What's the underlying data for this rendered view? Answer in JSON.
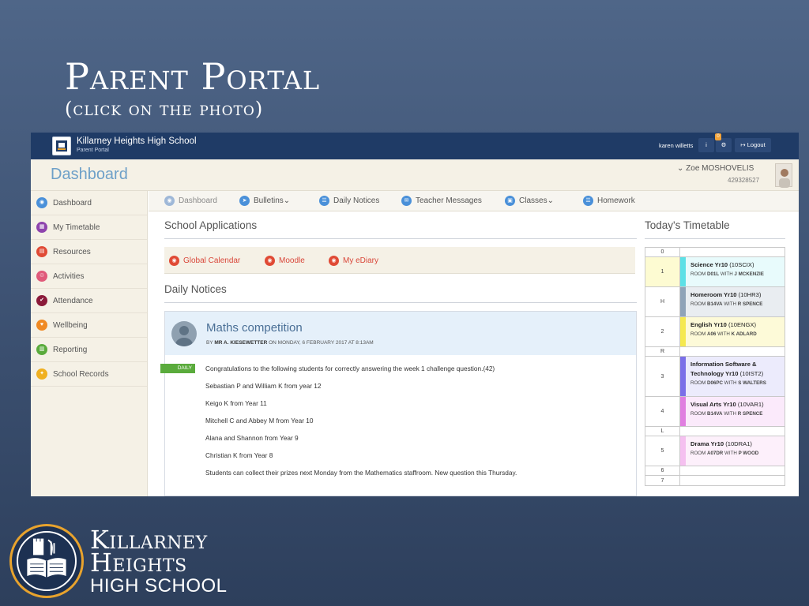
{
  "slide": {
    "title": "Parent Portal",
    "subtitle": "(click on the photo)"
  },
  "topbar": {
    "school_name": "Killarney Heights High School",
    "portal_name": "Parent Portal",
    "user": "karen willetts",
    "info_icon": "i",
    "settings_badge": "0",
    "logout_label": "↦ Logout"
  },
  "dashbar": {
    "title": "Dashboard",
    "student_name": "⌄  Zoe MOSHOVELIS",
    "student_id": "429328527"
  },
  "sidebar": {
    "items": [
      {
        "label": "Dashboard",
        "icon": "dashboard-icon",
        "color": "#4a90d9"
      },
      {
        "label": "My Timetable",
        "icon": "calendar-icon",
        "color": "#8e44ad"
      },
      {
        "label": "Resources",
        "icon": "folder-icon",
        "color": "#e04a35"
      },
      {
        "label": "Activities",
        "icon": "bike-icon",
        "color": "#e05a7a"
      },
      {
        "label": "Attendance",
        "icon": "check-icon",
        "color": "#8b1a3a"
      },
      {
        "label": "Wellbeing",
        "icon": "heart-icon",
        "color": "#f08a24"
      },
      {
        "label": "Reporting",
        "icon": "chart-icon",
        "color": "#5aab3c"
      },
      {
        "label": "School Records",
        "icon": "records-icon",
        "color": "#f0b020"
      }
    ]
  },
  "nav": {
    "items": [
      {
        "label": "Dashboard"
      },
      {
        "label": "Bulletins⌄"
      },
      {
        "label": "Daily Notices"
      },
      {
        "label": "Teacher Messages"
      },
      {
        "label": "Classes⌄"
      },
      {
        "label": "Homework"
      }
    ]
  },
  "main": {
    "apps_heading": "School Applications",
    "apps": [
      {
        "label": "Global Calendar"
      },
      {
        "label": "Moodle"
      },
      {
        "label": "My eDiary"
      }
    ],
    "notices_heading": "Daily Notices",
    "notice": {
      "title": "Maths competition",
      "by": "BY",
      "author": "MR A. KIESEWETTER",
      "date": "ON MONDAY, 6 FEBRUARY 2017 AT 8:13AM",
      "tag": "DAILY",
      "lines": [
        "Congratulations to the following students for correctly answering the week 1 challenge question.(42)",
        "Sebastian P and William K from year 12",
        "Keigo K from Year 11",
        "Mitchell C and Abbey M from Year 10",
        "Alana and Shannon from Year 9",
        "Christian K from Year 8",
        "Students can collect their prizes next Monday from the Mathematics staffroom. New question this Thursday."
      ]
    }
  },
  "timetable": {
    "title": "Today's Timetable",
    "rows": [
      {
        "period": "0",
        "subject": "",
        "code": "",
        "room": "",
        "teacher": "",
        "bar": "",
        "bg": "#ffffff",
        "numbg": "#ffffff"
      },
      {
        "period": "1",
        "subject": "Science Yr10",
        "code": "(10SCIX)",
        "room": "D01L",
        "teacher": "J MCKENZIE",
        "bar": "#5de0e6",
        "bg": "#e8fbfc",
        "numbg": "#fdfbd2"
      },
      {
        "period": "H",
        "subject": "Homeroom Yr10",
        "code": "(10HR3)",
        "room": "B14VA",
        "teacher": "R SPENCE",
        "bar": "#8fa3b8",
        "bg": "#e9edf1",
        "numbg": "#ffffff"
      },
      {
        "period": "2",
        "subject": "English Yr10",
        "code": "(10ENGX)",
        "room": "A06",
        "teacher": "K ADLARD",
        "bar": "#f5e94f",
        "bg": "#fdfad8",
        "numbg": "#ffffff"
      },
      {
        "period": "R",
        "subject": "",
        "code": "",
        "room": "",
        "teacher": "",
        "bar": "",
        "bg": "#ffffff",
        "numbg": "#ffffff"
      },
      {
        "period": "3",
        "subject": "Information Software & Technology Yr10",
        "code": "(10IST2)",
        "room": "D06PC",
        "teacher": "S WALTERS",
        "bar": "#7a6fe8",
        "bg": "#ecebfc",
        "numbg": "#ffffff"
      },
      {
        "period": "4",
        "subject": "Visual Arts Yr10",
        "code": "(10VAR1)",
        "room": "B14VA",
        "teacher": "R SPENCE",
        "bar": "#e07ee0",
        "bg": "#fbeafb",
        "numbg": "#ffffff"
      },
      {
        "period": "L",
        "subject": "",
        "code": "",
        "room": "",
        "teacher": "",
        "bar": "",
        "bg": "#ffffff",
        "numbg": "#ffffff"
      },
      {
        "period": "5",
        "subject": "Drama Yr10",
        "code": "(10DRA1)",
        "room": "A07DR",
        "teacher": "P WOOD",
        "bar": "#f5c0f0",
        "bg": "#fdf0fb",
        "numbg": "#ffffff"
      },
      {
        "period": "6",
        "subject": "",
        "code": "",
        "room": "",
        "teacher": "",
        "bar": "",
        "bg": "#ffffff",
        "numbg": "#ffffff"
      },
      {
        "period": "7",
        "subject": "",
        "code": "",
        "room": "",
        "teacher": "",
        "bar": "",
        "bg": "#ffffff",
        "numbg": "#ffffff"
      }
    ],
    "room_label": "ROOM",
    "with_label": "WITH"
  },
  "brand": {
    "line1": "Killarney",
    "line2": "Heights",
    "line3": "HIGH SCHOOL"
  },
  "colors": {
    "topbar": "#1f3b66",
    "accent_blue": "#4a90d9",
    "app_red": "#e04a35",
    "daily_green": "#5aab3c",
    "brand_gold": "#e8a32d"
  }
}
